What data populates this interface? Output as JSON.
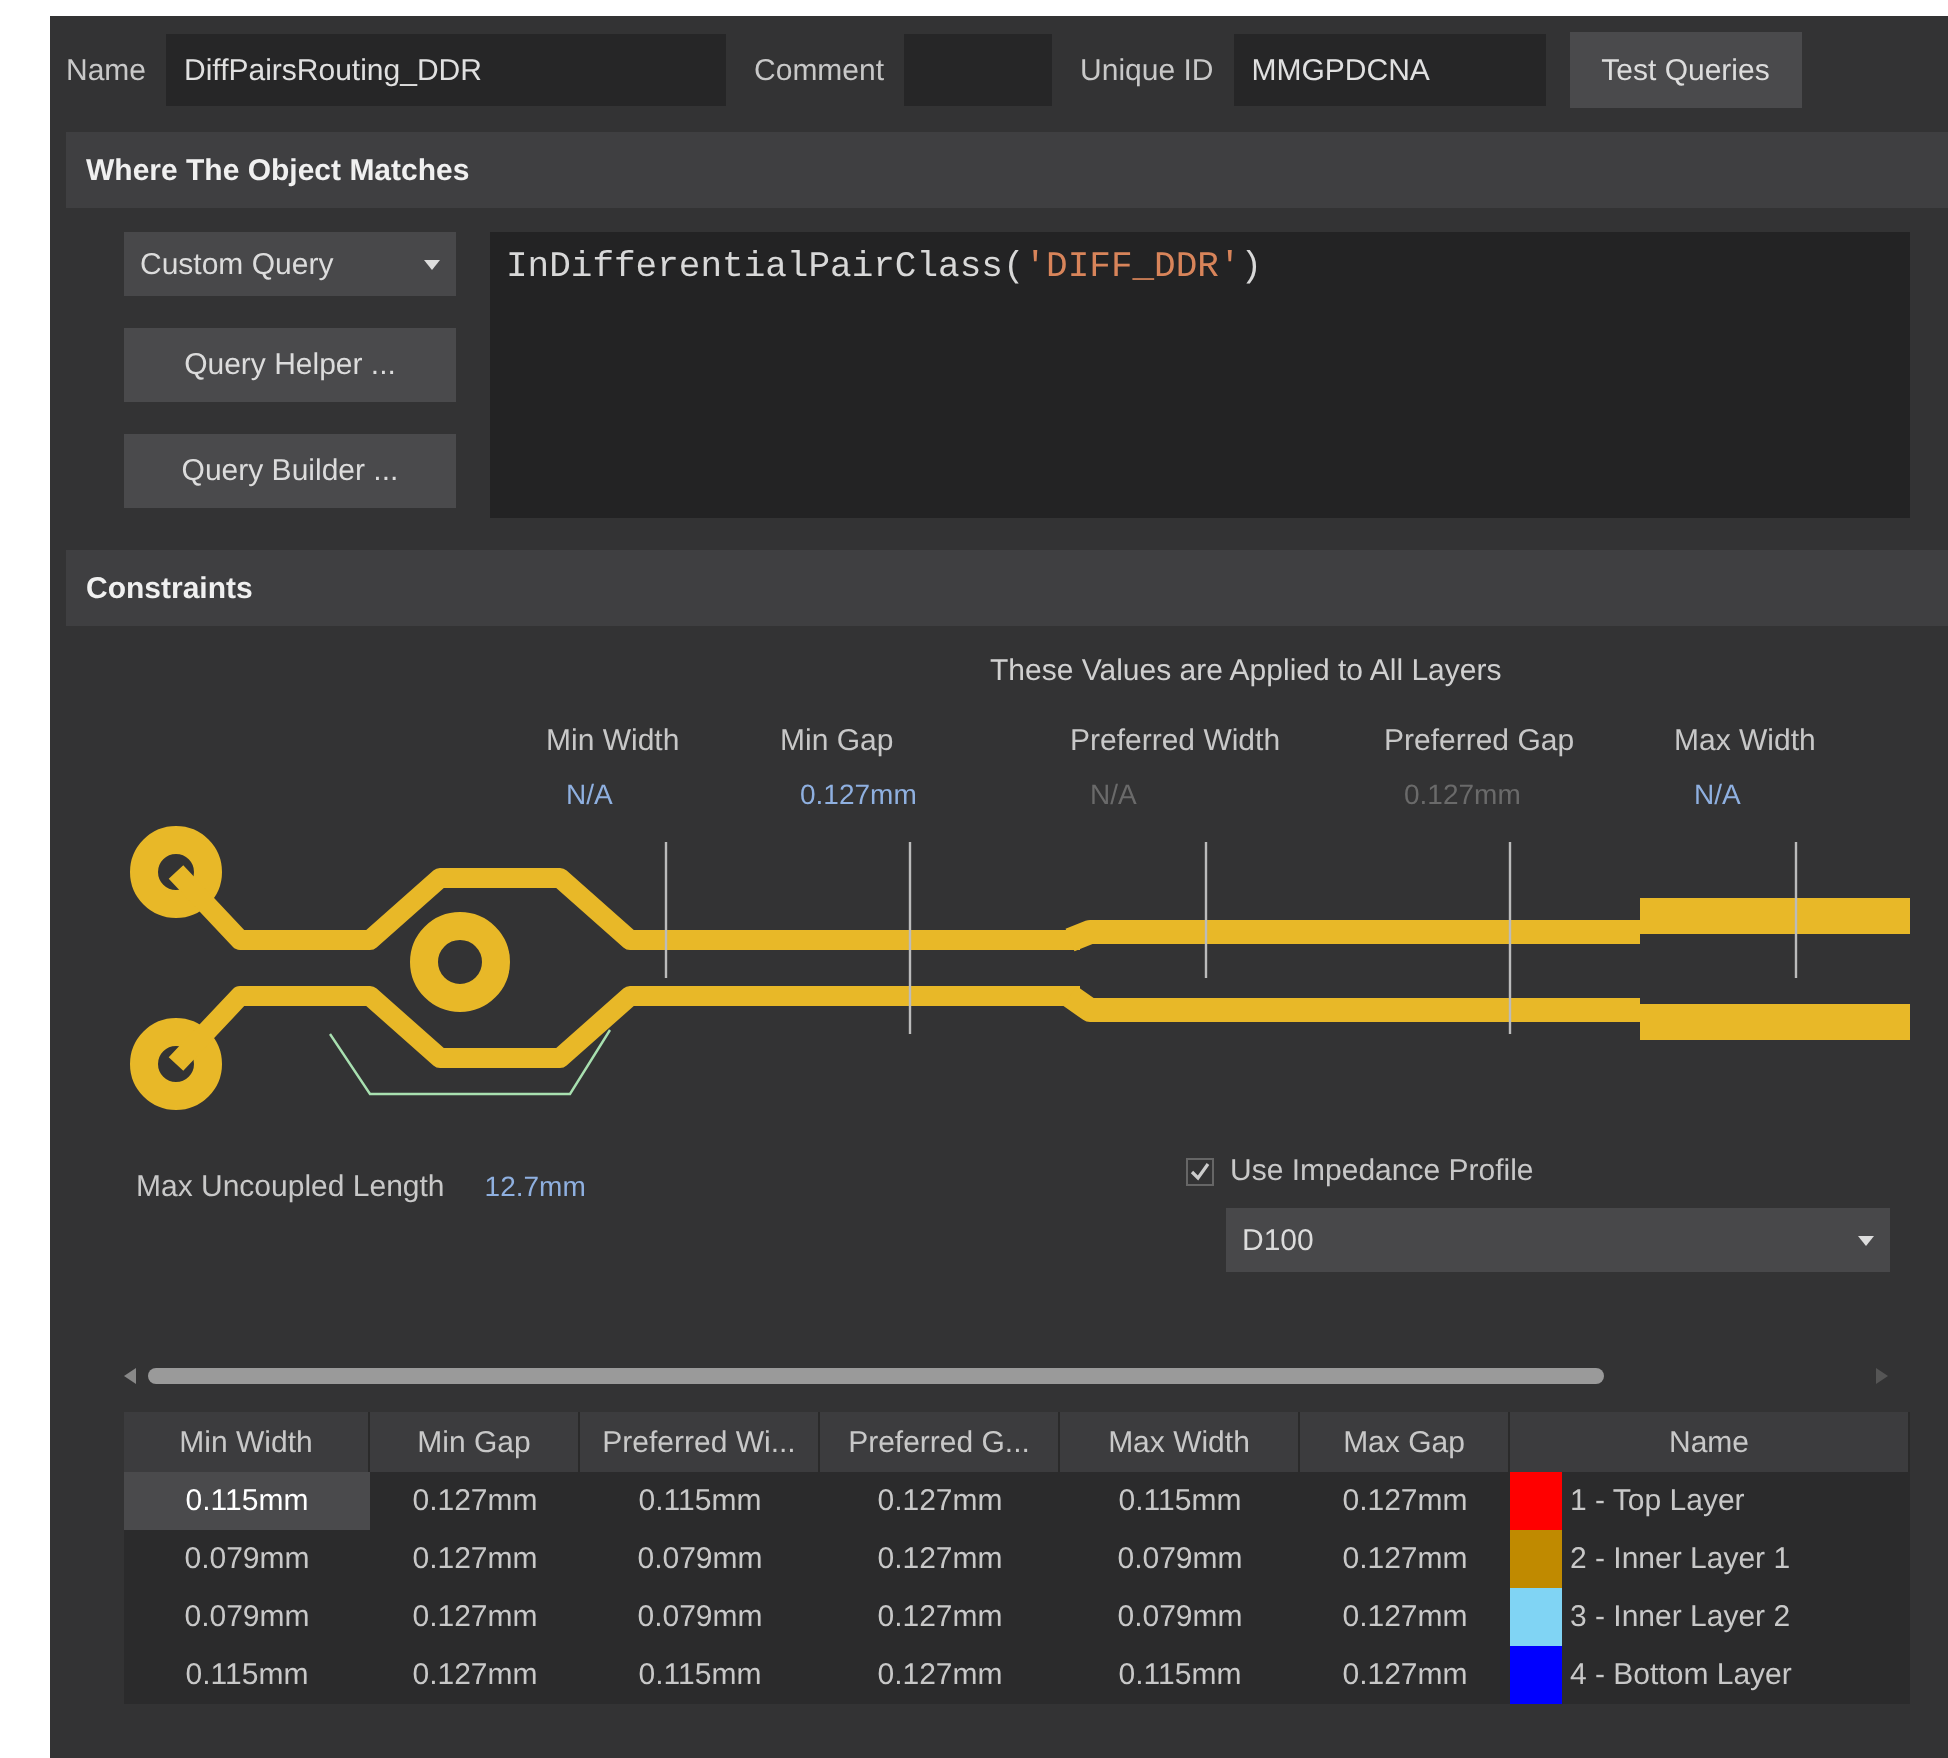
{
  "header": {
    "fields": [
      {
        "label": "Name",
        "value": "DiffPairsRouting_DDR",
        "kind": "name"
      },
      {
        "label": "Comment",
        "kind": "comment"
      },
      {
        "label": "Unique ID",
        "value": "MMGPDCNA",
        "kind": "uid"
      }
    ],
    "test_button": "Test Queries"
  },
  "query_section": {
    "title": "Where The Object Matches",
    "type_dropdown": "Custom Query",
    "buttons": [
      "Query Helper ...",
      "Query Builder ..."
    ],
    "query_parts": [
      {
        "text": "InDifferentialPairClass(",
        "kind": "code"
      },
      {
        "text": "'DIFF_DDR'",
        "kind": "string"
      },
      {
        "text": ")",
        "kind": "code"
      }
    ]
  },
  "constraints": {
    "title": "Constraints",
    "note": "These Values are Applied to All Layers",
    "parameters": [
      {
        "label": "Min Width",
        "value": "N/A",
        "disabled": false
      },
      {
        "label": "Min Gap",
        "value": "0.127mm",
        "disabled": false
      },
      {
        "label": "Preferred Width",
        "value": "N/A",
        "disabled": true
      },
      {
        "label": "Preferred Gap",
        "value": "0.127mm",
        "disabled": true
      },
      {
        "label": "Max Width",
        "value": "N/A",
        "disabled": false
      }
    ],
    "max_uncoupled_length": {
      "label": "Max Uncoupled Length",
      "value": "12.7mm"
    },
    "impedance": {
      "label": "Use Impedance Profile",
      "checked": true,
      "profile": "D100"
    }
  },
  "layer_table": {
    "columns": [
      "Min Width",
      "Min Gap",
      "Preferred Wi...",
      "Preferred G...",
      "Max Width",
      "Max Gap",
      "Name"
    ],
    "rows": [
      {
        "cells": [
          "0.115mm",
          "0.127mm",
          "0.115mm",
          "0.127mm",
          "0.115mm",
          "0.127mm"
        ],
        "name": "1 - Top Layer",
        "color": "#ff0000",
        "selected": true
      },
      {
        "cells": [
          "0.079mm",
          "0.127mm",
          "0.079mm",
          "0.127mm",
          "0.079mm",
          "0.127mm"
        ],
        "name": "2 - Inner Layer 1",
        "color": "#c08a00",
        "selected": false
      },
      {
        "cells": [
          "0.079mm",
          "0.127mm",
          "0.079mm",
          "0.127mm",
          "0.079mm",
          "0.127mm"
        ],
        "name": "3 - Inner Layer 2",
        "color": "#80d4f4",
        "selected": false
      },
      {
        "cells": [
          "0.115mm",
          "0.127mm",
          "0.115mm",
          "0.127mm",
          "0.115mm",
          "0.127mm"
        ],
        "name": "4 - Bottom Layer",
        "color": "#0000ff",
        "selected": false
      }
    ]
  }
}
